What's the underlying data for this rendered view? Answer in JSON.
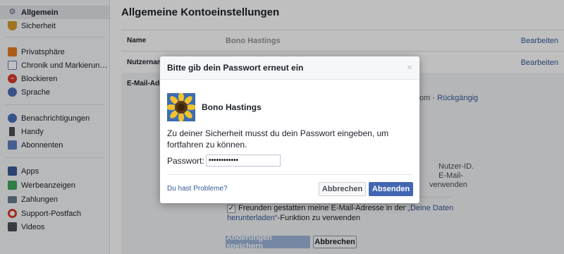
{
  "sidebar": {
    "items": [
      {
        "label": "Allgemein",
        "icon": "gears-icon",
        "color": "#7f8a9c"
      },
      {
        "label": "Sicherheit",
        "icon": "badge-icon",
        "color": "#d69a2d"
      },
      {
        "label": "Privatsphäre",
        "icon": "lock-icon",
        "color": "#e67e22"
      },
      {
        "label": "Chronik und Markierung...",
        "icon": "timeline-icon",
        "color": "#5b7fc0"
      },
      {
        "label": "Blockieren",
        "icon": "block-icon",
        "color": "#d93a2b"
      },
      {
        "label": "Sprache",
        "icon": "globe-icon",
        "color": "#4a6fb5"
      },
      {
        "label": "Benachrichtigungen",
        "icon": "globe-notify-icon",
        "color": "#4a6fb5"
      },
      {
        "label": "Handy",
        "icon": "phone-icon",
        "color": "#4b4f56"
      },
      {
        "label": "Abonnenten",
        "icon": "rss-icon",
        "color": "#5b7fc0"
      },
      {
        "label": "Apps",
        "icon": "apps-icon",
        "color": "#3b5998"
      },
      {
        "label": "Werbeanzeigen",
        "icon": "ads-icon",
        "color": "#42a85f"
      },
      {
        "label": "Zahlungen",
        "icon": "card-icon",
        "color": "#6b7a8f"
      },
      {
        "label": "Support-Postfach",
        "icon": "lifebuoy-icon",
        "color": "#d93a2b"
      },
      {
        "label": "Videos",
        "icon": "film-icon",
        "color": "#4b4f56"
      }
    ]
  },
  "main": {
    "title": "Allgemeine Kontoeinstellungen",
    "rows": [
      {
        "label": "Name",
        "value": "Bono Hastings",
        "action": "Bearbeiten"
      },
      {
        "label": "Nutzernam",
        "value": "",
        "action": "Bearbeiten"
      },
      {
        "label": "E-Mail-Adre",
        "value": "",
        "action": ""
      }
    ],
    "email_panel": {
      "frag_om": "om ·",
      "undo_link": "Rückgängig",
      "frag_nutzer_id": "Nutzer-ID.",
      "frag_email": "E-Mail-",
      "frag_verwenden": "verwenden",
      "checkbox_text_1": "Freunden gestatten meine E-Mail-Adresse in der ",
      "checkbox_link": "„Deine Daten herunterladen“",
      "checkbox_text_2": "-Funktion zu verwenden",
      "checkbox_link_line1": "„Deine Daten",
      "checkbox_link_line2": "herunterladen“",
      "save_label": "Änderungen speichern",
      "cancel_label": "Abbrechen"
    }
  },
  "dialog": {
    "title": "Bitte gib dein Passwort erneut ein",
    "close_symbol": "×",
    "user_name": "Bono Hastings",
    "message": "Zu deiner Sicherheit musst du dein Passwort eingeben, um fortfahren zu können.",
    "password_label": "Passwort:",
    "password_value": "••••••••••••",
    "help_link": "Du hast Probleme?",
    "cancel_label": "Abbrechen",
    "submit_label": "Absenden",
    "accent_color": "#4267b2"
  }
}
